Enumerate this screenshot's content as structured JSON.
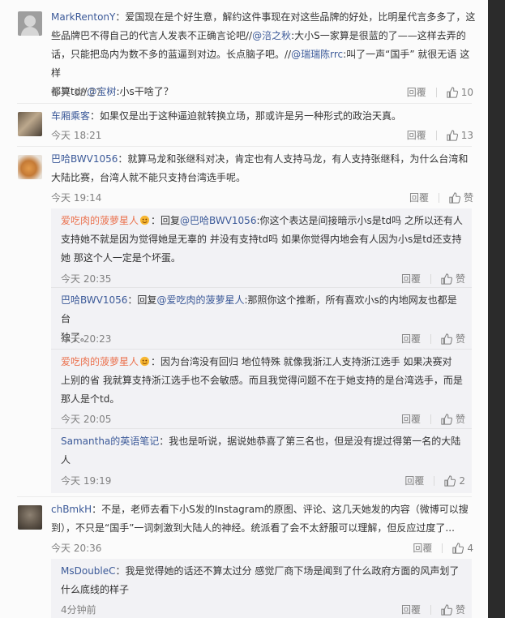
{
  "comments": [
    {
      "user": "MarkRentonY",
      "text_a": "：爱国现在是个好生意，解约这件事现在对这些品牌的好处，比明星代言多多了，这",
      "text_b": "些品牌巴不得自己的代言人发表不正确言论吧//",
      "mention1": "@涪之秋",
      "text_c": ":大小S一家算是很蓝的了——这样去弄的",
      "text_d": "话，只能把岛内为数不多的蓝逼到对边。长点脑子吧。//",
      "mention2": "@瑞瑞陈rrc",
      "text_e": ":叫了一声“国手” 就很无语 这样",
      "text_f": "都算td//",
      "mention3": "@宝树",
      "text_g": ":小s干啥了？",
      "time": "今天 18:27",
      "reply": "回覆",
      "likes": "10"
    },
    {
      "user": "车厢乘客",
      "text": "：如果仅是出于这种逼迫就转换立场，那或许是另一种形式的政治天真。",
      "time": "今天 18:21",
      "reply": "回覆",
      "likes": "13"
    },
    {
      "user": "巴哈BWV1056",
      "text_a": "：就算马龙和张继科对决，肯定也有人支持马龙，有人支持张继科，为什么台湾和",
      "text_b": "大陆比赛，台湾人就不能只支持台湾选手呢。",
      "time": "今天 19:14",
      "reply": "回覆",
      "likes": "赞"
    },
    {
      "user": "chBmkH",
      "text_a": "：不是，老师去看下小S发的Instagram的原图、评论、这几天她发的内容（微博可以搜",
      "text_b": "到），不只是“国手”一词刺激到大陆人的神经。统派看了会不太舒服可以理解，但反应过度了...",
      "time": "今天 20:36",
      "reply": "回覆",
      "likes": "4"
    }
  ],
  "replies": [
    {
      "user": "爱吃肉的菠萝星人",
      "text_a": "：回复",
      "mention": "@巴哈BWV1056",
      "text_b": ":你这个表达是间接暗示小s是td吗 之所以还有人",
      "text_c": "支持她不就是因为觉得她是无辜的 并没有支持td吗 如果你觉得内地会有人因为小s是td还支持",
      "text_d": "她 那这个人一定是个坏蛋。",
      "time": "今天 20:35",
      "reply": "回覆",
      "likes": "赞"
    },
    {
      "user": "巴哈BWV1056",
      "text_a": "：回复",
      "mention": "@爱吃肉的菠萝星人",
      "text_b": ":那照你这个推断，所有喜欢小s的内地网友也都是台",
      "text_c": "独了。",
      "time": "今天 20:23",
      "reply": "回覆",
      "likes": "赞"
    },
    {
      "user": "爱吃肉的菠萝星人",
      "text_a": "：因为台湾没有回归 地位特殊 就像我浙江人支持浙江选手 如果决赛对",
      "text_b": "上别的省 我就算支持浙江选手也不会敏感。而且我觉得问题不在于她支持的是台湾选手，而是",
      "text_c": "那人是个td。",
      "time": "今天 20:05",
      "reply": "回覆",
      "likes": "赞"
    },
    {
      "user": "Samantha的英语笔记",
      "text_a": "：我也是听说，据说她恭喜了第三名也，但是没有提过得第一名的大陆",
      "text_b": "人",
      "time": "今天 19:19",
      "reply": "回覆",
      "likes": "2"
    },
    {
      "user": "MsDoubleC",
      "text_a": "：我是觉得她的话还不算太过分 感觉厂商下场是闻到了什么政府方面的风声划了",
      "text_b": "什么底线的样子",
      "time": "4分钟前",
      "reply": "回覆",
      "likes": "赞"
    }
  ],
  "colors": {
    "link": "#3b5998",
    "muted": "#808080",
    "sub_bg": "#f2f2f5"
  },
  "icons": [
    "thumbs-up-icon",
    "vip-badge-icon"
  ]
}
